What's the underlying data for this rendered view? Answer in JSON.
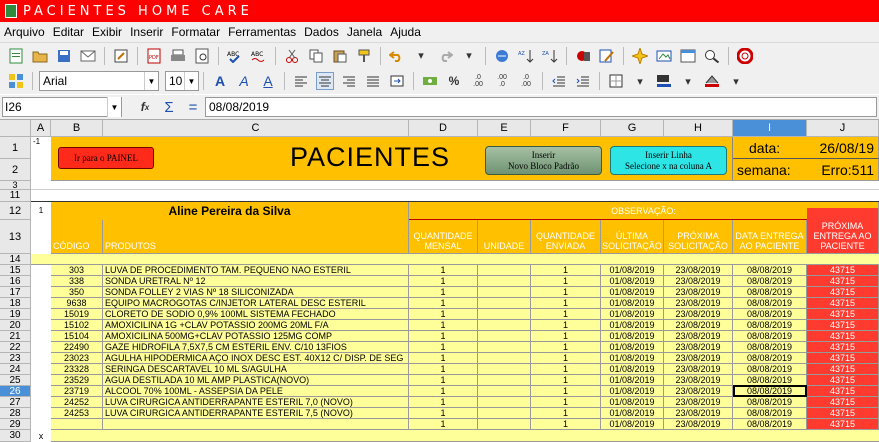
{
  "window": {
    "title": "PACIENTES  HOME  CARE"
  },
  "menu": [
    "Arquivo",
    "Editar",
    "Exibir",
    "Inserir",
    "Formatar",
    "Ferramentas",
    "Dados",
    "Janela",
    "Ajuda"
  ],
  "toolbar": {
    "font_name": "Arial",
    "font_size": "10"
  },
  "formula_bar": {
    "cell_ref": "I26",
    "value": "08/08/2019"
  },
  "columns": [
    "A",
    "B",
    "C",
    "D",
    "E",
    "F",
    "G",
    "H",
    "I",
    "J"
  ],
  "sheet": {
    "row1_a": "-1",
    "btn_painel": "Ir para o PAINEL",
    "title": "PACIENTES",
    "btn_inserir_bloco": "Inserir\nNovo Bloco Padrão",
    "btn_inserir_linha": "Inserir Linha\nSelecione x na coluna A",
    "data_label": "data:",
    "data_value": "26/08/19",
    "semana_label": "semana:",
    "semana_value": "Erro:511",
    "row12_a": "1",
    "patient_name": "Aline Pereira da Silva",
    "observacao": "OBSERVAÇÃO:",
    "headers": {
      "codigo": "CÓDIGO",
      "produtos": "PRODUTOS",
      "qtd_mensal": "QUANTIDADE MENSAL",
      "unidade": "UNIDADE",
      "qtd_enviada": "QUANTIDADE ENVIADA",
      "ultima": "ÚLTIMA SOLICITAÇÃO",
      "proxima": "PRÓXIMA SOLICITAÇÃO",
      "data_entrega": "DATA ENTREGA AO PACIENTE",
      "proxima_entrega": "PRÓXIMA ENTREGA AO PACIENTE"
    },
    "row30_a": "x"
  },
  "rows": [
    {
      "r": "15",
      "code": "303",
      "prod": "LUVA DE PROCEDIMENTO TAM. PEQUENO NAO ESTERIL",
      "qm": "1",
      "qe": "1",
      "ult": "01/08/2019",
      "prox": "23/08/2019",
      "ent": "08/08/2019",
      "pe": "43715"
    },
    {
      "r": "16",
      "code": "338",
      "prod": "SONDA URETRAL Nº 12",
      "qm": "1",
      "qe": "1",
      "ult": "01/08/2019",
      "prox": "23/08/2019",
      "ent": "08/08/2019",
      "pe": "43715"
    },
    {
      "r": "17",
      "code": "350",
      "prod": "SONDA FOLLEY 2 VIAS Nº 18 SILICONIZADA",
      "qm": "1",
      "qe": "1",
      "ult": "01/08/2019",
      "prox": "23/08/2019",
      "ent": "08/08/2019",
      "pe": "43715"
    },
    {
      "r": "18",
      "code": "9638",
      "prod": "EQUIPO MACROGOTAS C/INJETOR LATERAL DESC ESTERIL",
      "qm": "1",
      "qe": "1",
      "ult": "01/08/2019",
      "prox": "23/08/2019",
      "ent": "08/08/2019",
      "pe": "43715"
    },
    {
      "r": "19",
      "code": "15019",
      "prod": "CLORETO DE SODIO 0,9% 100ML SISTEMA FECHADO",
      "qm": "1",
      "qe": "1",
      "ult": "01/08/2019",
      "prox": "23/08/2019",
      "ent": "08/08/2019",
      "pe": "43715"
    },
    {
      "r": "20",
      "code": "15102",
      "prod": "AMOXICILINA 1G +CLAV POTASSIO 200MG 20ML F/A",
      "qm": "1",
      "qe": "1",
      "ult": "01/08/2019",
      "prox": "23/08/2019",
      "ent": "08/08/2019",
      "pe": "43715"
    },
    {
      "r": "21",
      "code": "15104",
      "prod": "AMOXICILINA 500MG+CLAV POTASSIO 125MG COMP",
      "qm": "1",
      "qe": "1",
      "ult": "01/08/2019",
      "prox": "23/08/2019",
      "ent": "08/08/2019",
      "pe": "43715"
    },
    {
      "r": "22",
      "code": "22490",
      "prod": "GAZE HIDROFILA 7,5X7,5 CM ESTERIL ENV. C/10 13FIOS",
      "qm": "1",
      "qe": "1",
      "ult": "01/08/2019",
      "prox": "23/08/2019",
      "ent": "08/08/2019",
      "pe": "43715"
    },
    {
      "r": "23",
      "code": "23023",
      "prod": "AGULHA HIPODERMICA AÇO INOX DESC EST. 40X12 C/ DISP. DE SEG",
      "qm": "1",
      "qe": "1",
      "ult": "01/08/2019",
      "prox": "23/08/2019",
      "ent": "08/08/2019",
      "pe": "43715"
    },
    {
      "r": "24",
      "code": "23328",
      "prod": "SERINGA DESCARTAVEL 10 ML S/AGULHA",
      "qm": "1",
      "qe": "1",
      "ult": "01/08/2019",
      "prox": "23/08/2019",
      "ent": "08/08/2019",
      "pe": "43715"
    },
    {
      "r": "25",
      "code": "23529",
      "prod": "AGUA DESTILADA 10 ML AMP PLASTICA(NOVO)",
      "qm": "1",
      "qe": "1",
      "ult": "01/08/2019",
      "prox": "23/08/2019",
      "ent": "08/08/2019",
      "pe": "43715"
    },
    {
      "r": "26",
      "code": "23719",
      "prod": "ALCOOL 70% 100ML -  ASSEPSIA DA PELE",
      "qm": "1",
      "qe": "1",
      "ult": "01/08/2019",
      "prox": "23/08/2019",
      "ent": "08/08/2019",
      "pe": "43715"
    },
    {
      "r": "27",
      "code": "24252",
      "prod": "LUVA CIRURGICA ANTIDERRAPANTE ESTERIL 7,0 (NOVO)",
      "qm": "1",
      "qe": "1",
      "ult": "01/08/2019",
      "prox": "23/08/2019",
      "ent": "08/08/2019",
      "pe": "43715"
    },
    {
      "r": "28",
      "code": "24253",
      "prod": "LUVA CIRURGICA ANTIDERRAPANTE ESTERIL 7,5 (NOVO)",
      "qm": "1",
      "qe": "1",
      "ult": "01/08/2019",
      "prox": "23/08/2019",
      "ent": "08/08/2019",
      "pe": "43715"
    },
    {
      "r": "29",
      "code": "",
      "prod": "",
      "qm": "1",
      "qe": "1",
      "ult": "01/08/2019",
      "prox": "23/08/2019",
      "ent": "08/08/2019",
      "pe": "43715"
    }
  ],
  "row_headers_top": [
    "1",
    "2",
    "3",
    "11",
    "12",
    "13",
    "14"
  ],
  "row_header_last": "30"
}
